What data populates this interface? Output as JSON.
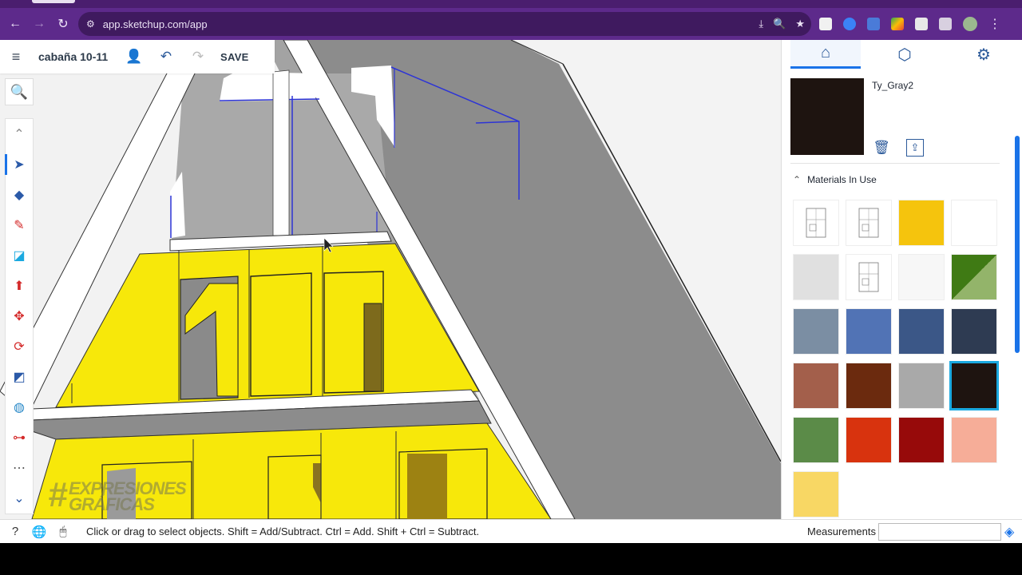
{
  "browser": {
    "url": "app.sketchup.com/app",
    "nav": {
      "back": "←",
      "forward": "→",
      "reload": "↻",
      "site_info": "⚙"
    },
    "url_icons": [
      "⤓",
      "🔍",
      "★"
    ]
  },
  "app": {
    "doc_title": "cabaña 10-11",
    "save_label": "SAVE",
    "menu_icon": "≡",
    "collab_icon": "👤",
    "undo_icon": "↶",
    "redo_icon": "↷"
  },
  "tools": {
    "search": "🔍",
    "items": [
      {
        "name": "collapse-up-icon",
        "glyph": "⌃",
        "color": "#888"
      },
      {
        "name": "select-icon",
        "glyph": "➤",
        "color": "#2b5aa8",
        "active": true
      },
      {
        "name": "eraser-icon",
        "glyph": "◆",
        "color": "#2b5aa8"
      },
      {
        "name": "pencil-icon",
        "glyph": "✎",
        "color": "#d42a2a"
      },
      {
        "name": "rectangle-icon",
        "glyph": "◪",
        "color": "#1aa9e0"
      },
      {
        "name": "push-pull-icon",
        "glyph": "⬆",
        "color": "#d42a2a"
      },
      {
        "name": "move-icon",
        "glyph": "✥",
        "color": "#d42a2a"
      },
      {
        "name": "rotate-icon",
        "glyph": "⟳",
        "color": "#d42a2a"
      },
      {
        "name": "scale-icon",
        "glyph": "◩",
        "color": "#2b5aa8"
      },
      {
        "name": "paint-bucket-icon",
        "glyph": "◍",
        "color": "#2b8ac8"
      },
      {
        "name": "tape-measure-icon",
        "glyph": "⊶",
        "color": "#d42a2a"
      },
      {
        "name": "more-tools-icon",
        "glyph": "⋯",
        "color": "#555"
      },
      {
        "name": "expand-down-icon",
        "glyph": "⌄",
        "color": "#2b5aa8"
      }
    ]
  },
  "watermark": {
    "hash": "#",
    "line1": "EXPRESIONES",
    "line2": "GRÁFICAS"
  },
  "panel": {
    "tabs": [
      {
        "name": "home-icon",
        "glyph": "⌂",
        "active": true
      },
      {
        "name": "cube-icon",
        "glyph": "⬡",
        "active": false
      },
      {
        "name": "settings-gear-icon",
        "glyph": "⚙",
        "active": false
      }
    ],
    "material_name": "Ty_Gray2",
    "material_color": "#1e1410",
    "delete_icon": "🗑",
    "export_icon": "⇪",
    "section_title": "Materials In Use",
    "materials": [
      {
        "type": "plan",
        "color": "#ffffff"
      },
      {
        "type": "plan",
        "color": "#ffffff"
      },
      {
        "type": "solid",
        "color": "#f5c40d"
      },
      {
        "type": "solid",
        "color": "#ffffff"
      },
      {
        "type": "solid",
        "color": "#e0e0e0"
      },
      {
        "type": "plan",
        "color": "#ffffff"
      },
      {
        "type": "solid",
        "color": "#f7f7f7"
      },
      {
        "type": "split",
        "color": "#3f7a14",
        "color2": "#93b46a"
      },
      {
        "type": "solid",
        "color": "#7b8ea3"
      },
      {
        "type": "solid",
        "color": "#5173b5"
      },
      {
        "type": "solid",
        "color": "#3b5787"
      },
      {
        "type": "solid",
        "color": "#2e3b52"
      },
      {
        "type": "solid",
        "color": "#a35f4b"
      },
      {
        "type": "solid",
        "color": "#6b2a0e"
      },
      {
        "type": "solid",
        "color": "#a9a9a9"
      },
      {
        "type": "solid",
        "color": "#1e1410",
        "selected": true
      },
      {
        "type": "solid",
        "color": "#5b8b48"
      },
      {
        "type": "solid",
        "color": "#d8330e"
      },
      {
        "type": "solid",
        "color": "#970a0a"
      },
      {
        "type": "solid",
        "color": "#f6ad98"
      },
      {
        "type": "solid",
        "color": "#f8d764"
      }
    ]
  },
  "status": {
    "help_icon": "?",
    "globe_icon": "🌐",
    "mouse_icon": "🖱",
    "hint": "Click or drag to select objects. Shift = Add/Subtract. Ctrl = Add. Shift + Ctrl = Subtract.",
    "measurements_label": "Measurements",
    "measurements_value": ""
  }
}
